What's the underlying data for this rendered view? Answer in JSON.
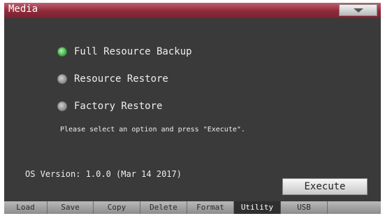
{
  "window": {
    "title": "Media"
  },
  "options": [
    {
      "label": "Full Resource Backup",
      "selected": true
    },
    {
      "label": "Resource Restore",
      "selected": false
    },
    {
      "label": "Factory Restore",
      "selected": false
    }
  ],
  "hint": "Please select an option and press \"Execute\".",
  "version_text": "OS Version: 1.0.0 (Mar 14 2017)",
  "execute_label": "Execute",
  "tabs": [
    {
      "label": "Load"
    },
    {
      "label": "Save"
    },
    {
      "label": "Copy"
    },
    {
      "label": "Delete"
    },
    {
      "label": "Format"
    },
    {
      "label": "Utility",
      "active": true
    },
    {
      "label": "USB"
    }
  ],
  "colors": {
    "titlebar": "#8d2a3a",
    "background": "#3a3a3a",
    "selected_radio": "#49b24f",
    "active_tab": "#2f2f2f"
  },
  "icons": [
    "menu-dropdown-icon",
    "radio-selected-icon",
    "radio-unselected-icon"
  ]
}
